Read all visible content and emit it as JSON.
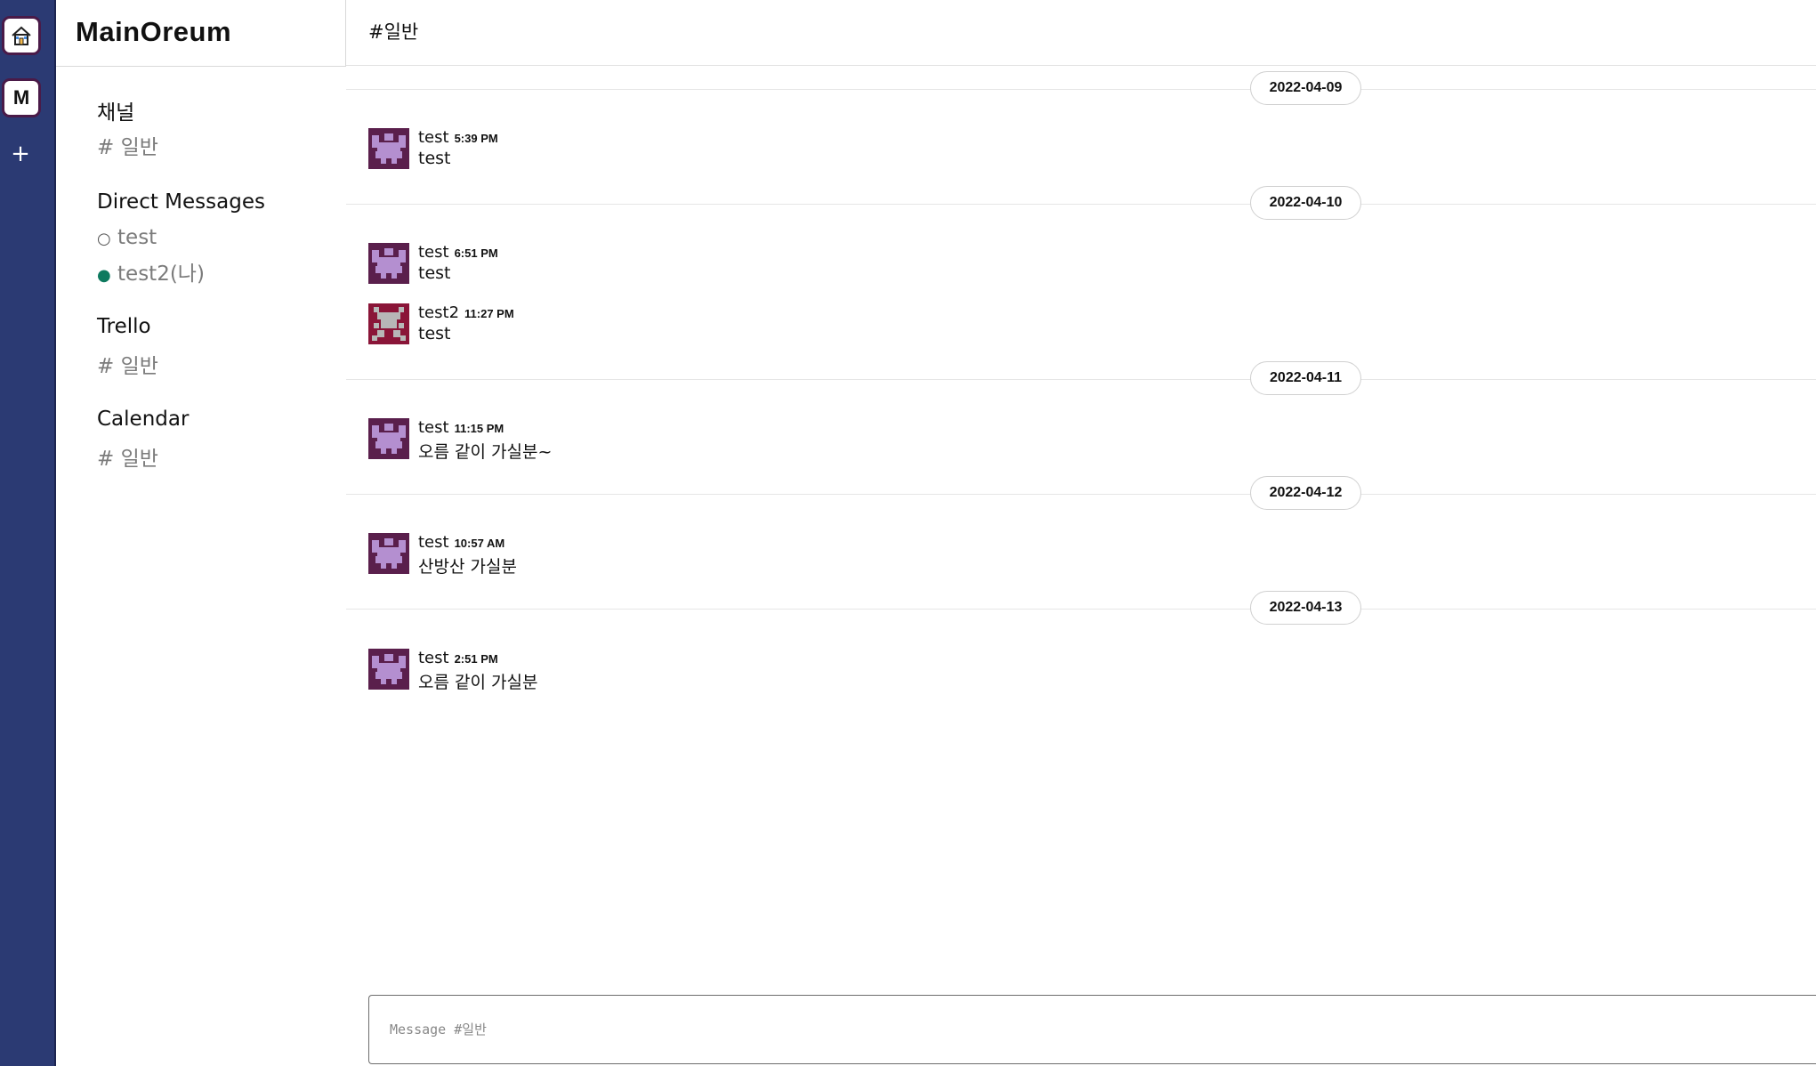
{
  "workspace": {
    "home_icon": "home-icon",
    "workspace_initial": "M",
    "add_label": "+"
  },
  "sidebar": {
    "brand": "MainOreum",
    "channels": {
      "title": "채널",
      "items": [
        {
          "label": "# 일반"
        }
      ]
    },
    "dms": {
      "title": "Direct Messages",
      "items": [
        {
          "status_symbol": "○",
          "label": "test",
          "status": "offline"
        },
        {
          "status_symbol": "●",
          "label": "test2(나)",
          "status": "online"
        }
      ]
    },
    "trello": {
      "title": "Trello",
      "items": [
        {
          "label": "# 일반"
        }
      ]
    },
    "calendar": {
      "title": "Calendar",
      "items": [
        {
          "label": "# 일반"
        }
      ]
    }
  },
  "main": {
    "header": "#일반",
    "days": [
      {
        "date": "2022-04-09",
        "messages": [
          {
            "user": "test",
            "time": "5:39 PM",
            "text": "test",
            "avatar": "purple"
          }
        ]
      },
      {
        "date": "2022-04-10",
        "messages": [
          {
            "user": "test",
            "time": "6:51 PM",
            "text": "test",
            "avatar": "purple"
          },
          {
            "user": "test2",
            "time": "11:27 PM",
            "text": "test",
            "avatar": "red"
          }
        ]
      },
      {
        "date": "2022-04-11",
        "messages": [
          {
            "user": "test",
            "time": "11:15 PM",
            "text": "오름 같이 가실분~",
            "avatar": "purple"
          }
        ]
      },
      {
        "date": "2022-04-12",
        "messages": [
          {
            "user": "test",
            "time": "10:57 AM",
            "text": "산방산 가실분",
            "avatar": "purple"
          }
        ]
      },
      {
        "date": "2022-04-13",
        "messages": [
          {
            "user": "test",
            "time": "2:51 PM",
            "text": "오름 같이 가실분",
            "avatar": "purple"
          }
        ]
      }
    ],
    "composer_placeholder": "Message #일반"
  },
  "colors": {
    "rail": "#2b3a73",
    "avatar_purple_bg": "#5a1f4c",
    "avatar_purple_fg": "#b48fd0",
    "avatar_red_bg": "#8a1538",
    "avatar_red_fg": "#b7b7b7",
    "online": "#0e7a5f"
  }
}
